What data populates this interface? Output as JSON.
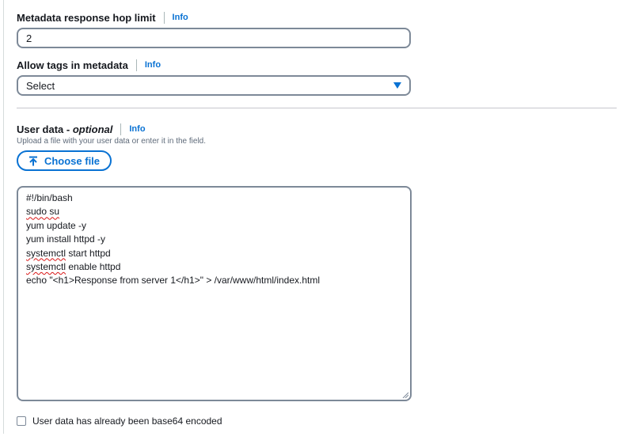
{
  "hop_limit": {
    "label": "Metadata response hop limit",
    "info": "Info",
    "value": "2"
  },
  "tags_in_metadata": {
    "label": "Allow tags in metadata",
    "info": "Info",
    "selected": "Select"
  },
  "user_data": {
    "label": "User data -",
    "label_optional": "optional",
    "info": "Info",
    "description": "Upload a file with your user data or enter it in the field.",
    "choose_file": "Choose file",
    "lines": [
      {
        "pre": "#!/bin/bash",
        "squiggle": "",
        "post": ""
      },
      {
        "pre": "",
        "squiggle": "sudo su",
        "post": ""
      },
      {
        "pre": "yum update -y",
        "squiggle": "",
        "post": ""
      },
      {
        "pre": "yum install httpd -y",
        "squiggle": "",
        "post": ""
      },
      {
        "pre": "",
        "squiggle": "systemctl",
        "post": " start httpd"
      },
      {
        "pre": "",
        "squiggle": "systemctl",
        "post": " enable httpd"
      },
      {
        "pre": "echo \"<h1>Response from server 1</h1>\" > /var/www/html/index.html",
        "squiggle": "",
        "post": ""
      }
    ],
    "base64_label": "User data has already been base64 encoded"
  },
  "colors": {
    "accent": "#0972d3",
    "border": "#7d8998",
    "text": "#16191f",
    "spellcheck": "#d91515"
  },
  "icons": {
    "choose_file": "upload-arrow-icon",
    "select": "caret-down-icon"
  }
}
